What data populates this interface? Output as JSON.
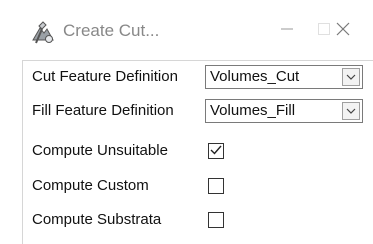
{
  "window": {
    "title": "Create Cut...",
    "icon": "earthwork-tools-icon"
  },
  "titlebar_buttons": {
    "minimize_icon": "minimize-icon",
    "maximize_icon": "maximize-icon",
    "close_icon": "close-icon"
  },
  "form": {
    "cut_feature": {
      "label": "Cut Feature Definition",
      "value": "Volumes_Cut"
    },
    "fill_feature": {
      "label": "Fill Feature Definition",
      "value": "Volumes_Fill"
    },
    "compute_unsuitable": {
      "label": "Compute Unsuitable",
      "checked": true
    },
    "compute_custom": {
      "label": "Compute Custom",
      "checked": false
    },
    "compute_substrata": {
      "label": "Compute Substrata",
      "checked": false
    }
  }
}
